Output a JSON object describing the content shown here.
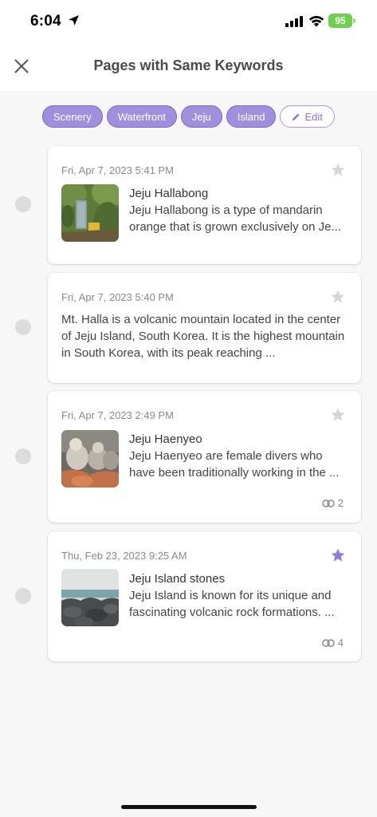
{
  "status_bar": {
    "time": "6:04",
    "battery": "95"
  },
  "header": {
    "title": "Pages with Same Keywords"
  },
  "keywords": [
    "Scenery",
    "Waterfront",
    "Jeju",
    "Island"
  ],
  "edit_label": "Edit",
  "accent_color": "#a08fdc",
  "cards": [
    {
      "date": "Fri, Apr 7, 2023 5:41 PM",
      "title": "Jeju Hallabong",
      "snippet": "Jeju Hallabong is a type of mandarin orange that is grown exclusively on Je...",
      "starred": false
    },
    {
      "date": "Fri, Apr 7, 2023 5:40 PM",
      "snippet": "Mt. Halla is a volcanic mountain located in the center of Jeju Island, South Korea. It is the highest mountain in South Korea, with its peak reaching ...",
      "starred": false
    },
    {
      "date": "Fri, Apr 7, 2023 2:49 PM",
      "title": "Jeju Haenyeo",
      "snippet": "Jeju Haenyeo are female divers who have been traditionally working in the ...",
      "links": "2",
      "starred": false
    },
    {
      "date": "Thu, Feb 23, 2023 9:25 AM",
      "title": "Jeju Island stones",
      "snippet": "Jeju Island is known for its unique and fascinating volcanic rock formations. ...",
      "links": "4",
      "starred": true
    }
  ]
}
